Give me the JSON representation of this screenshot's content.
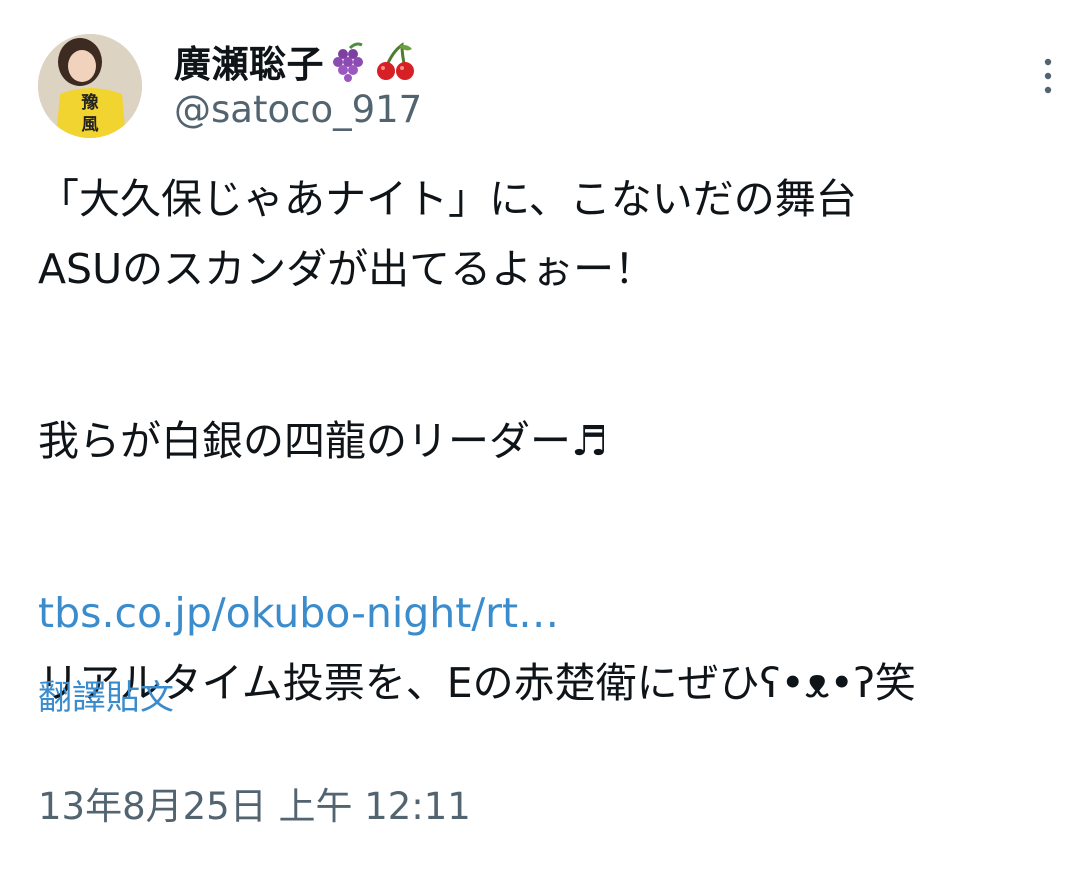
{
  "author": {
    "display_name": "廣瀬聡子",
    "emoji_1": "grape-emoji",
    "emoji_2": "cherry-emoji",
    "handle": "@satoco_917",
    "avatar_text_1": "豫",
    "avatar_text_2": "風"
  },
  "tweet": {
    "line_1": "「大久保じゃあナイト」に、こないだの舞台",
    "line_2": "ASUのスカンダが出てるよぉー！",
    "line_3": "我らが白銀の四龍のリーダー♬",
    "link": "tbs.co.jp/okubo-night/rt…",
    "line_4": "リアルタイム投票を、Eの赤楚衛にぜひʕ•ᴥ•ʔ笑"
  },
  "actions": {
    "translate_label": "翻譯貼文",
    "more_icon": "more-vertical-icon"
  },
  "timestamp": "13年8月25日 上午 12:11",
  "colors": {
    "link": "#3a8ccd",
    "secondary_text": "#536471",
    "primary_text": "#0f1419"
  }
}
